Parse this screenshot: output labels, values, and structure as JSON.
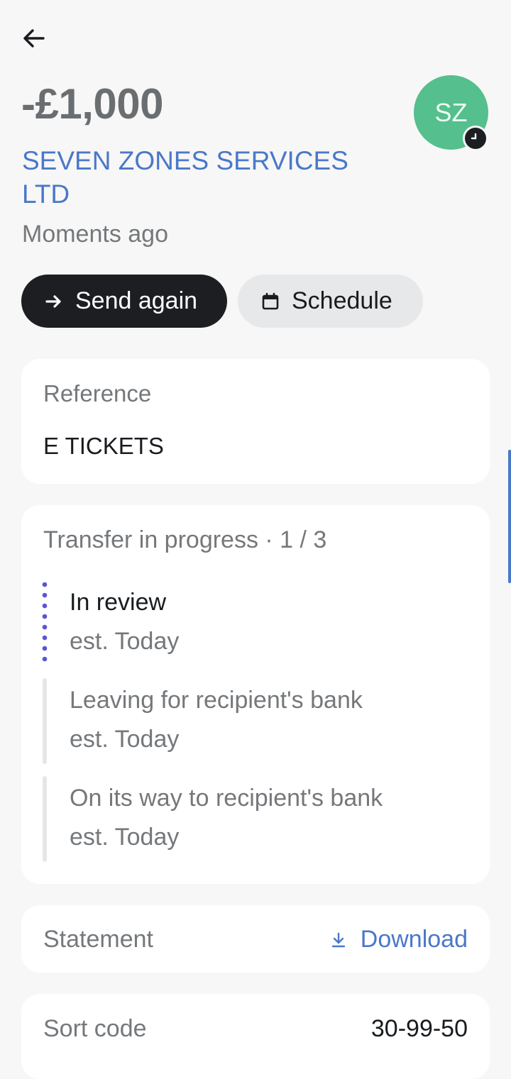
{
  "header": {
    "back_icon": "arrow-left-icon",
    "amount": "-£1,000",
    "merchant": "SEVEN ZONES SERVICES LTD",
    "time": "Moments ago",
    "avatar_initials": "SZ",
    "avatar_color": "#55bf8d",
    "avatar_badge_icon": "clock-icon"
  },
  "actions": {
    "send_again": {
      "label": "Send again",
      "icon": "arrow-right-icon"
    },
    "schedule": {
      "label": "Schedule",
      "icon": "calendar-icon"
    }
  },
  "reference": {
    "label": "Reference",
    "value": "E TICKETS"
  },
  "progress": {
    "title": "Transfer in progress · 1 / 3",
    "steps": [
      {
        "title": "In review",
        "eta": "est. Today",
        "state": "current"
      },
      {
        "title": "Leaving for recipient's bank",
        "eta": "est. Today",
        "state": "pending"
      },
      {
        "title": "On its way to recipient's bank",
        "eta": "est. Today",
        "state": "pending"
      }
    ]
  },
  "statement": {
    "label": "Statement",
    "download_label": "Download",
    "download_icon": "download-icon"
  },
  "details": {
    "sort_code_label": "Sort code",
    "sort_code_value": "30-99-50"
  },
  "colors": {
    "accent": "#4a78c8",
    "progress_dots": "#5a55d6",
    "primary_button": "#1c1e21"
  }
}
